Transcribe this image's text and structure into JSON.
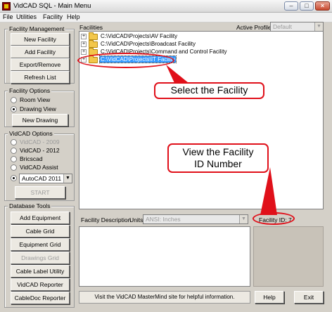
{
  "window": {
    "title": "VidCAD SQL - Main Menu"
  },
  "menu": [
    "File",
    "Utilities",
    "Facility",
    "Help"
  ],
  "facility_management": {
    "title": "Facility Management",
    "buttons": [
      "New Facility",
      "Add Facility",
      "Export/Remove",
      "Refresh List"
    ]
  },
  "facility_options": {
    "title": "Facility Options",
    "radios": [
      "Room View",
      "Drawing View"
    ],
    "selected": "Drawing View",
    "new_drawing": "New Drawing"
  },
  "vidcad_options": {
    "title": "VidCAD Options",
    "radios": [
      "VidCAD - 2009",
      "VidCAD - 2012",
      "Bricscad",
      "VidCAD Assist"
    ],
    "autocad_value": "AutoCAD 2011",
    "start": "START"
  },
  "database_tools": {
    "title": "Database Tools",
    "buttons": [
      "Add Equipment",
      "Cable Grid",
      "Equipment Grid",
      "Drawings Grid",
      "Cable Label Utility",
      "VidCAD Reporter",
      "CableDoc Reporter"
    ]
  },
  "facilities": {
    "label": "Facilities",
    "active_profile_label": "Active Profile",
    "active_profile_value": "Default",
    "items": [
      "C:\\VidCAD\\Projects\\AV Facility",
      "C:\\VidCAD\\Projects\\Broadcast Facility",
      "C:\\VidCAD\\Projects\\Command and Control Facility",
      "C:\\VidCAD\\Projects\\IT Facility"
    ]
  },
  "callouts": {
    "select": "Select the Facility",
    "view_id_line1": "View the Facility",
    "view_id_line2": "ID Number"
  },
  "description": {
    "label": "Facility Description",
    "units_label": "Units:",
    "units_value": "ANSI: Inches",
    "facility_id": "Facility ID: 7"
  },
  "bottom": {
    "info": "Visit the VidCAD MasterMind site for helpful information.",
    "help": "Help",
    "exit": "Exit"
  },
  "colors": {
    "callout_red": "#e0101a",
    "selection_blue": "#3399ff"
  }
}
